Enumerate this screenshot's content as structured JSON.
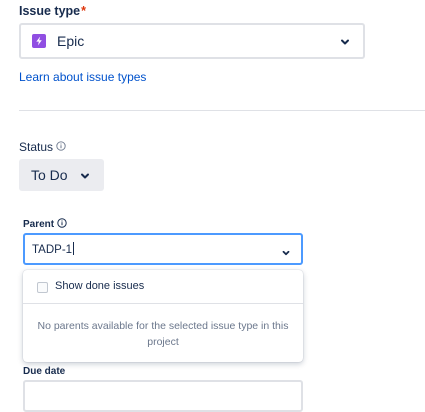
{
  "issue_type": {
    "label": "Issue type",
    "required_marker": "*",
    "selected_value": "Epic",
    "icon": "epic-lightning-icon",
    "learn_link": "Learn about issue types"
  },
  "status": {
    "label": "Status",
    "value": "To Do"
  },
  "parent": {
    "label": "Parent",
    "input_value": "TADP-1",
    "dropdown": {
      "checkbox_label": "Show done issues",
      "checked": false,
      "empty_message": "No parents available for the selected issue type in this project"
    }
  },
  "due_date": {
    "label": "Due date"
  },
  "colors": {
    "epic": "#904ee2",
    "link": "#0052cc",
    "focus_border": "#4c9aff",
    "required": "#de350b"
  }
}
